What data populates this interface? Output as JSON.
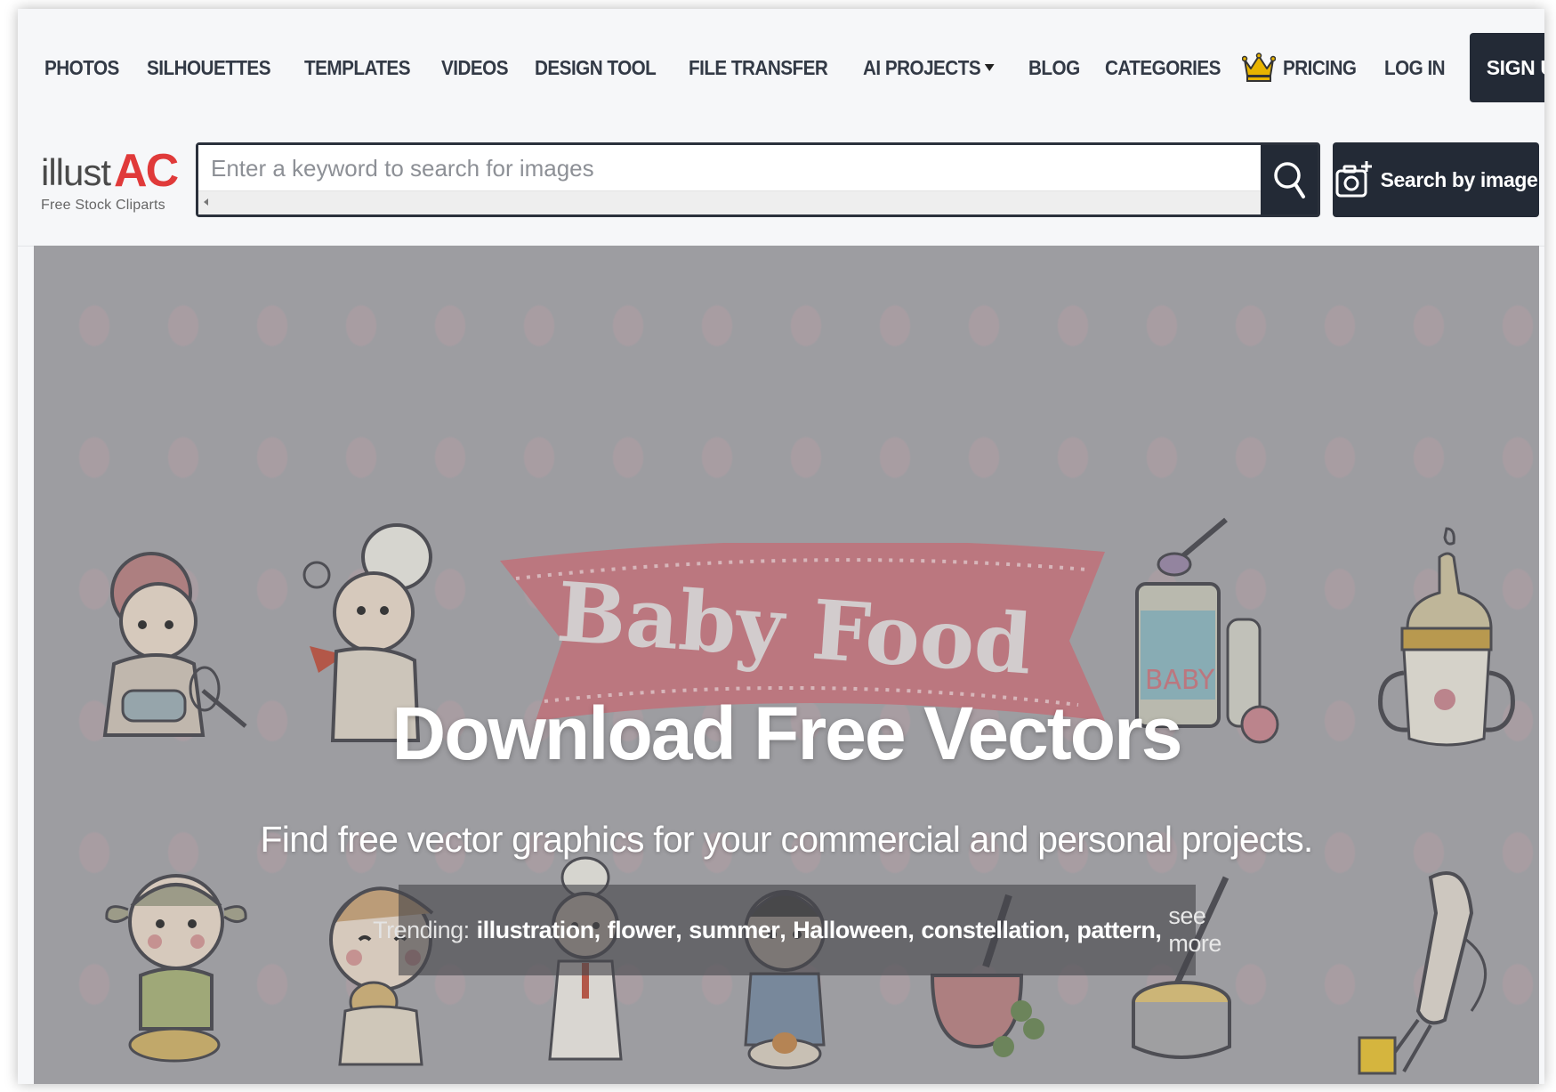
{
  "nav": {
    "links": [
      "PHOTOS",
      "SILHOUETTES",
      "TEMPLATES",
      "VIDEOS",
      "DESIGN TOOL",
      "FILE TRANSFER",
      "AI PROJECTS",
      "BLOG",
      "CATEGORIES"
    ],
    "pricing": "PRICING",
    "login": "LOG IN",
    "signup": "SIGN UP",
    "icons": {
      "crown": "crown-icon",
      "dropdown": "caret-down-icon"
    }
  },
  "logo": {
    "word": "illust",
    "mark": "AC",
    "tagline": "Free Stock Cliparts"
  },
  "search": {
    "placeholder": "Enter a keyword to search for images",
    "value": "",
    "image_search_label": "Search by image",
    "icons": {
      "search": "search-icon",
      "image_search": "camera-plus-icon"
    }
  },
  "hero": {
    "banner_text": "Baby Food",
    "can_label": "BABY",
    "title": "Download Free Vectors",
    "subtitle": "Find free vector graphics for your commercial and personal projects.",
    "trending_label": "Trending:",
    "trending_tags": [
      "illustration",
      "flower",
      "summer",
      "Halloween",
      "constellation",
      "pattern"
    ],
    "see_more": "see more"
  },
  "colors": {
    "dark_button": "#232a36",
    "logo_accent": "#e03a3a",
    "hero_bg": "#a7a7aa",
    "banner": "#c97b83",
    "crown": "#e8b400"
  }
}
